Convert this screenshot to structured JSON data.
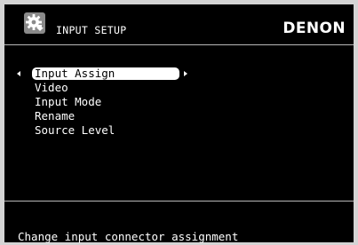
{
  "header": {
    "icon": "gear-setup-icon",
    "title": "INPUT SETUP",
    "brand": "DENON"
  },
  "menu": {
    "items": [
      {
        "label": "Input Assign",
        "selected": true
      },
      {
        "label": "Video",
        "selected": false
      },
      {
        "label": "Input Mode",
        "selected": false
      },
      {
        "label": "Rename",
        "selected": false
      },
      {
        "label": "Source Level",
        "selected": false
      }
    ]
  },
  "status": {
    "text": "Change input connector assignment"
  },
  "colors": {
    "background": "#000000",
    "frame": "#d4d4d4",
    "text": "#ffffff",
    "highlight": "#ffffff"
  }
}
